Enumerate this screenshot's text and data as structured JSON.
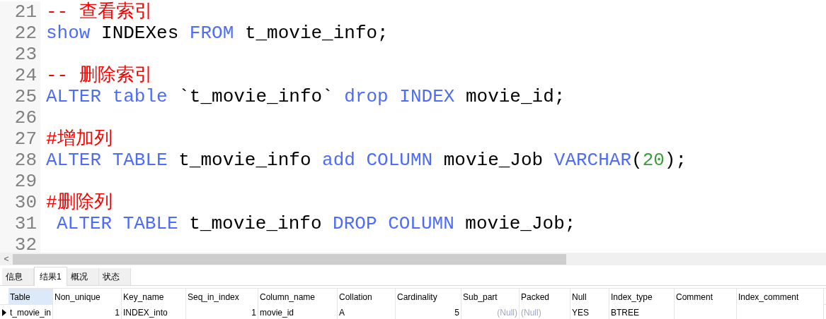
{
  "editor": {
    "lines": [
      {
        "number": "21",
        "tokens": [
          {
            "kind": "comment",
            "text": "-- 查看索引"
          }
        ]
      },
      {
        "number": "22",
        "tokens": [
          {
            "kind": "keyword",
            "text": "show"
          },
          {
            "kind": "plain",
            "text": "INDEXes"
          },
          {
            "kind": "keyword",
            "text": "FROM"
          },
          {
            "kind": "plain",
            "text": "t_movie_info;"
          }
        ]
      },
      {
        "number": "23"
      },
      {
        "number": "24",
        "tokens": [
          {
            "kind": "comment",
            "text": "-- 删除索引"
          }
        ]
      },
      {
        "number": "25",
        "tokens": [
          {
            "kind": "keyword",
            "text": "ALTER"
          },
          {
            "kind": "keyword",
            "text": "table"
          },
          {
            "kind": "plain",
            "text": "`t_movie_info`"
          },
          {
            "kind": "keyword",
            "text": "drop"
          },
          {
            "kind": "keyword",
            "text": "INDEX"
          },
          {
            "kind": "plain",
            "text": "movie_id;"
          }
        ]
      },
      {
        "number": "26"
      },
      {
        "number": "27",
        "tokens": [
          {
            "kind": "comment",
            "text": "#增加列"
          }
        ]
      },
      {
        "number": "28",
        "tokens": [
          {
            "kind": "keyword",
            "text": "ALTER"
          },
          {
            "kind": "keyword",
            "text": "TABLE"
          },
          {
            "kind": "plain",
            "text": "t_movie_info"
          },
          {
            "kind": "keyword",
            "text": "add"
          },
          {
            "kind": "keyword",
            "text": "COLUMN"
          },
          {
            "kind": "plain",
            "text": "movie_Job"
          },
          {
            "kind": "keyword",
            "text": "VARCHAR"
          },
          {
            "kind": "plain",
            "text": "(",
            "joined": true
          },
          {
            "kind": "number",
            "text": "20",
            "joined": true
          },
          {
            "kind": "plain",
            "text": ");",
            "joined": true
          }
        ]
      },
      {
        "number": "29"
      },
      {
        "number": "30",
        "tokens": [
          {
            "kind": "comment",
            "text": "#删除列"
          }
        ]
      },
      {
        "number": "31",
        "indented": true,
        "tokens": [
          {
            "kind": "keyword",
            "text": "ALTER"
          },
          {
            "kind": "keyword",
            "text": "TABLE"
          },
          {
            "kind": "plain",
            "text": "t_movie_info"
          },
          {
            "kind": "keyword",
            "text": "DROP"
          },
          {
            "kind": "keyword",
            "text": "COLUMN"
          },
          {
            "kind": "plain",
            "text": "movie_Job;"
          }
        ]
      },
      {
        "number": "32"
      }
    ]
  },
  "scrollbar": {
    "arrow": "<"
  },
  "tabs": [
    {
      "label": "信息",
      "selected": false
    },
    {
      "label": "结果1",
      "selected": true
    },
    {
      "label": "概况",
      "selected": false
    },
    {
      "label": "状态",
      "selected": false
    }
  ],
  "table": {
    "columns": [
      {
        "label": "Table",
        "selected": true
      },
      {
        "label": "Non_unique",
        "selected": false
      },
      {
        "label": "Key_name",
        "selected": false
      },
      {
        "label": "Seq_in_index",
        "selected": false
      },
      {
        "label": "Column_name",
        "selected": false
      },
      {
        "label": "Collation",
        "selected": false
      },
      {
        "label": "Cardinality",
        "selected": false
      },
      {
        "label": "Sub_part",
        "selected": false
      },
      {
        "label": "Packed",
        "selected": false
      },
      {
        "label": "Null",
        "selected": false
      },
      {
        "label": "Index_type",
        "selected": false
      },
      {
        "label": "Comment",
        "selected": false
      },
      {
        "label": "Index_comment",
        "selected": false
      }
    ],
    "rows": [
      {
        "current": true,
        "cells": [
          {
            "kind": "text",
            "text": "t_movie_in"
          },
          {
            "kind": "number",
            "text": "1"
          },
          {
            "kind": "text",
            "text": "INDEX_into"
          },
          {
            "kind": "number",
            "text": "1"
          },
          {
            "kind": "text",
            "text": "movie_id"
          },
          {
            "kind": "text",
            "text": "A"
          },
          {
            "kind": "number",
            "text": "5"
          },
          {
            "kind": "null_number",
            "text": "(Null)"
          },
          {
            "kind": "null_text",
            "text": "(Null)"
          },
          {
            "kind": "text",
            "text": "YES"
          },
          {
            "kind": "text",
            "text": "BTREE"
          },
          {
            "kind": "empty"
          },
          {
            "kind": "empty"
          }
        ]
      }
    ]
  }
}
